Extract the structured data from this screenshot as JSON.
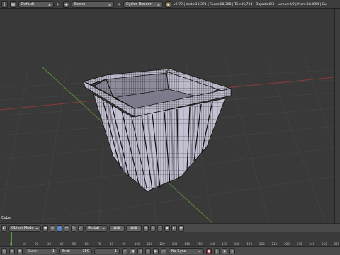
{
  "topbar": {
    "layout": "Default",
    "scene": "Scene",
    "engine": "Cycles Render",
    "stats": "v2.79 | Verts:18,371 | Faces:18,368 | Tris:36,704 | Objects:0/3 | Lamps:0/0 | Mem:58.49M | Cu"
  },
  "viewport": {
    "object_name": "Cube"
  },
  "header3d": {
    "mode": "Object Mode",
    "pivot": "Global"
  },
  "timeline": {
    "ticks": [
      "0",
      "10",
      "20",
      "30",
      "40",
      "50",
      "60",
      "70",
      "80",
      "90",
      "100",
      "110",
      "120",
      "130",
      "140",
      "150",
      "160",
      "170",
      "180",
      "190",
      "200",
      "210",
      "220",
      "230",
      "240",
      "250",
      "260"
    ],
    "current_frame": 1
  },
  "footer": {
    "start_label": "Start:",
    "start_value": "1",
    "end_label": "End:",
    "end_value": "250",
    "current_value": "1",
    "sync": "No Sync"
  },
  "colors": {
    "mesh_face": "#b8b6c6",
    "mesh_wire": "#151515",
    "grid": "#4a4a4a",
    "x_axis": "#8a3a3a",
    "y_axis": "#5a8a3a",
    "accent_blue": "#5680c2"
  }
}
